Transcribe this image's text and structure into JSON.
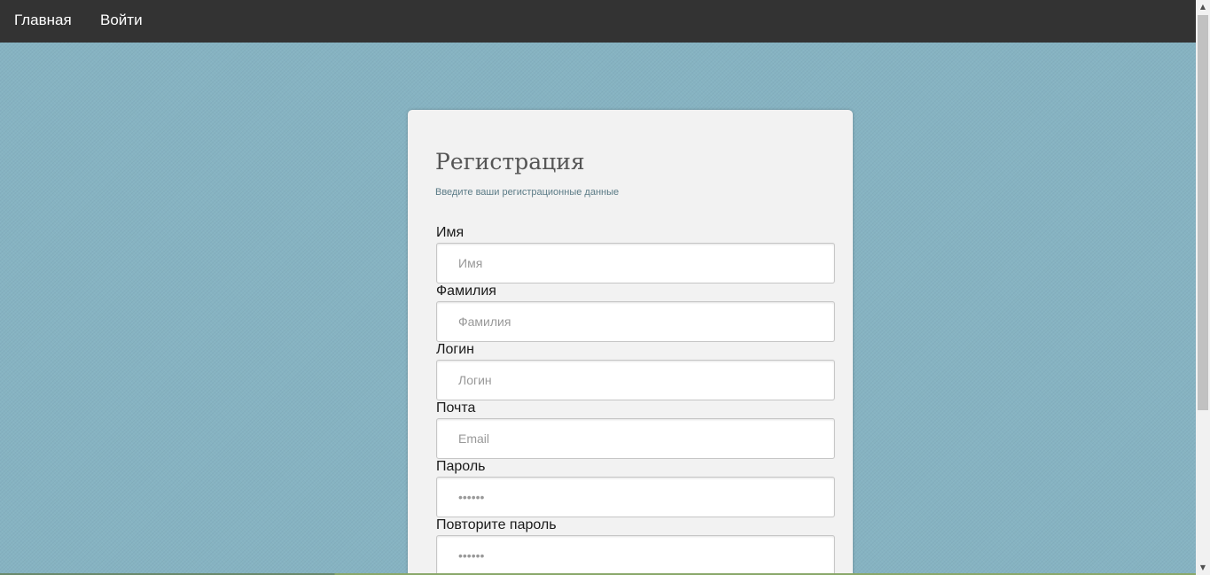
{
  "nav": {
    "home_label": "Главная",
    "login_label": "Войти"
  },
  "card": {
    "title": "Регистрация",
    "subtitle": "Введите ваши регистрационные данные",
    "fields": [
      {
        "label": "Имя",
        "placeholder": "Имя"
      },
      {
        "label": "Фамилия",
        "placeholder": "Фамилия"
      },
      {
        "label": "Логин",
        "placeholder": "Логин"
      },
      {
        "label": "Почта",
        "placeholder": "Email"
      },
      {
        "label": "Пароль",
        "placeholder": "••••••"
      },
      {
        "label": "Повторите пароль",
        "placeholder": "••••••"
      }
    ]
  },
  "icons": {
    "scroll_up": "scroll-up-arrow-icon",
    "scroll_down": "scroll-down-arrow-icon"
  },
  "colors": {
    "navbar": "#333333",
    "background": "#86b3c2",
    "card": "#f2f2f2"
  }
}
